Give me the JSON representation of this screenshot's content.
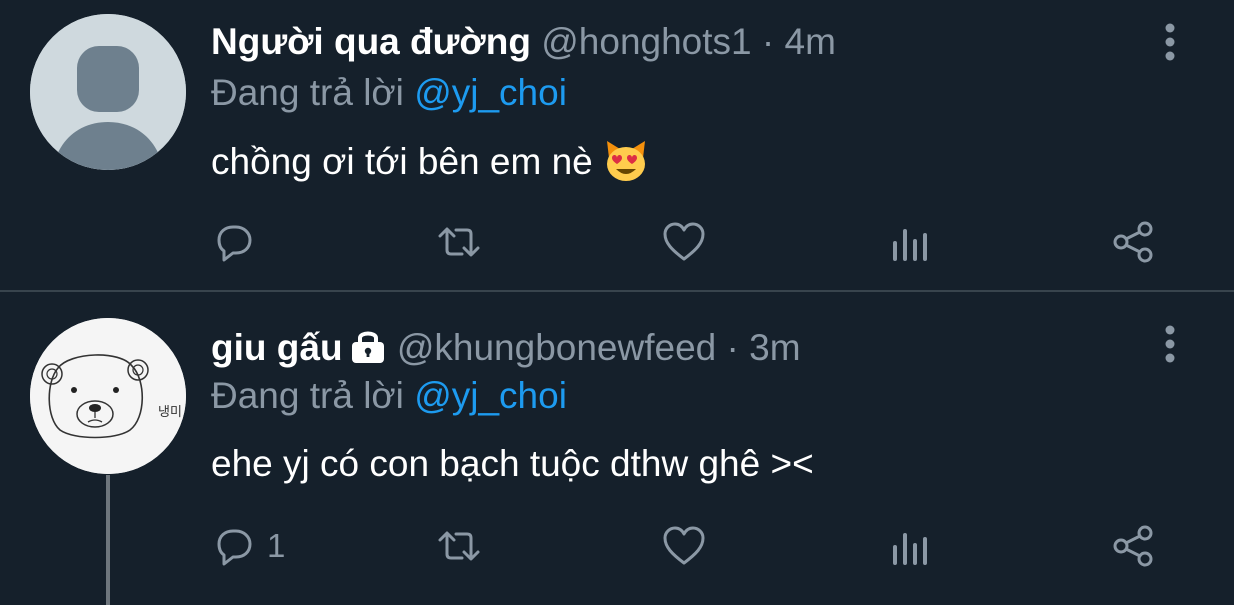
{
  "tweets": [
    {
      "name": "Người qua đường",
      "handle": "@honghots1",
      "separator": "·",
      "time": "4m",
      "reply_prefix": "Đang trả lời",
      "reply_to": "@yj_choi",
      "text": "chồng ơi tới bên em nè",
      "emoji": "heart-eyes-cat-emoji",
      "reply_count": "",
      "avatar": "default-avatar",
      "locked": false
    },
    {
      "name": "giu gấu",
      "handle": "@khungbonewfeed",
      "separator": "·",
      "time": "3m",
      "reply_prefix": "Đang trả lời",
      "reply_to": "@yj_choi",
      "text": "ehe yj có con bạch tuộc dthw ghê ><",
      "reply_count": "1",
      "avatar": "bear-drawing-avatar",
      "avatar_lettering": "냉미",
      "locked": true
    }
  ],
  "colors": {
    "background": "#15202b",
    "divider": "#38444d",
    "secondary_text": "#8b98a5",
    "link": "#1d9bf0",
    "primary_text": "#ffffff"
  }
}
